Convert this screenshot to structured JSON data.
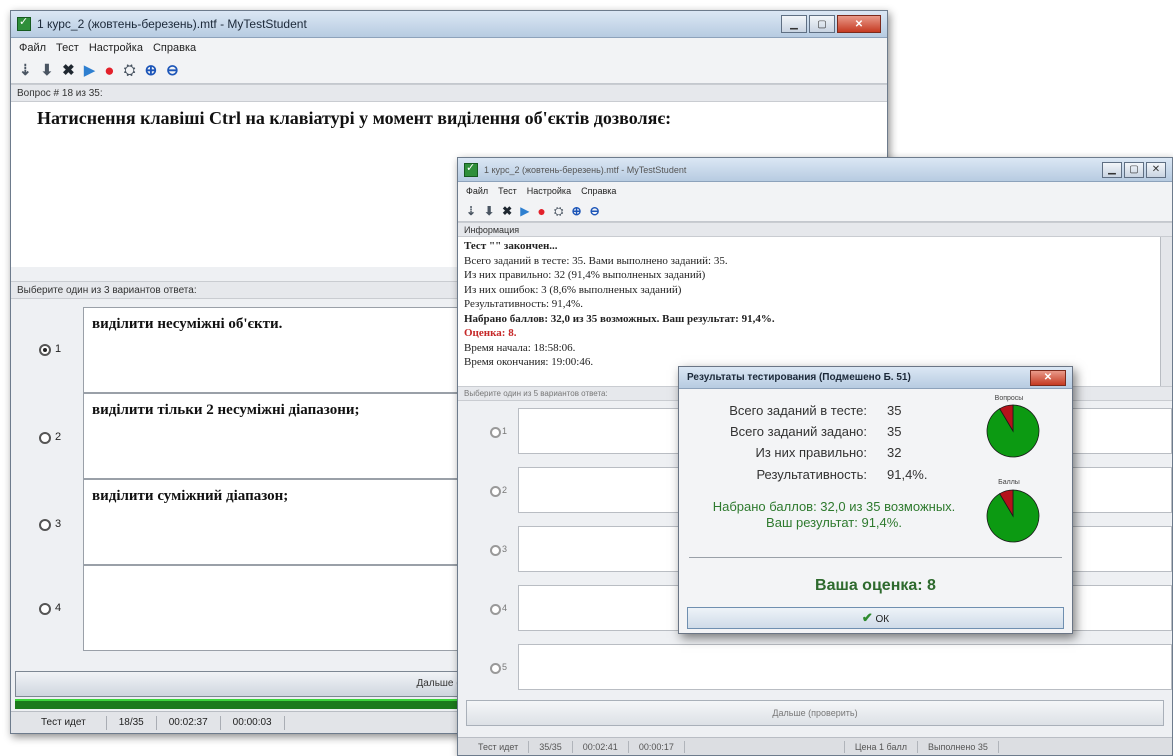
{
  "window_back": {
    "title": "1 курс_2  (жовтень-березень).mtf - MyTestStudent",
    "menu": [
      "Файл",
      "Тест",
      "Настройка",
      "Справка"
    ],
    "question_label": "Вопрос # 18 из 35:",
    "question_text": "Натиснення клавіші Ctrl на клавіатурі у момент виділення  об'єктів дозволяє:",
    "answers_label": "Выберите один из 3 вариантов ответа:",
    "answers": [
      {
        "num": "1",
        "text": "виділити несуміжні об'єкти."
      },
      {
        "num": "2",
        "text": "виділити тільки 2 несуміжні діапазони;"
      },
      {
        "num": "3",
        "text": "виділити суміжний діапазон;"
      },
      {
        "num": "4",
        "text": ""
      }
    ],
    "next_button": "Дальше (пров",
    "status": [
      "Тест идет",
      "18/35",
      "00:02:37",
      "00:00:03"
    ]
  },
  "window_front": {
    "title": "1 курс_2  (жовтень-березень).mtf - MyTestStudent",
    "menu": [
      "Файл",
      "Тест",
      "Настройка",
      "Справка"
    ],
    "info_label": "Информация",
    "info_lines": [
      "Тест \"\" закончен...",
      "Всего заданий в тесте: 35. Вами выполнено заданий: 35.",
      "Из них правильно: 32 (91,4% выполненых заданий)",
      "Из них ошибок: 3 (8,6% выполненых заданий)",
      "Результативность: 91,4%.",
      "Набрано баллов: 32,0 из 35 возможных. Ваш результат: 91,4%.",
      "Оценка: 8.",
      "Время начала: 18:58:06.",
      "Время окончания: 19:00:46."
    ],
    "answers_label": "Выберите один из 5 вариантов ответа:",
    "radios": [
      "1",
      "2",
      "3",
      "4",
      "5"
    ],
    "next_button": "Дальше (проверить)",
    "status": [
      "Тест идет",
      "35/35",
      "00:02:41",
      "00:00:17",
      "Цена 1 балл",
      "Выполнено 35"
    ]
  },
  "dialog": {
    "title": "Результаты тестирования (Подмешено Б. 51)",
    "rows": [
      {
        "label": "Всего заданий в тесте:",
        "value": "35"
      },
      {
        "label": "Всего заданий задано:",
        "value": "35"
      },
      {
        "label": "Из них правильно:",
        "value": "32"
      },
      {
        "label": "Результативность:",
        "value": "91,4%."
      }
    ],
    "score_line1": "Набрано баллов: 32,0 из 35 возможных.",
    "score_line2": "Ваш результат: 91,4%.",
    "grade": "Ваша оценка: 8",
    "ok": "ОК",
    "pie_labels": [
      "Вопросы",
      "Баллы"
    ]
  },
  "chart_data": [
    {
      "type": "pie",
      "slices": [
        {
          "value": 32,
          "color": "#0c9a12"
        },
        {
          "value": 3,
          "color": "#b5121b"
        }
      ]
    },
    {
      "type": "pie",
      "slices": [
        {
          "value": 32,
          "color": "#0c9a12"
        },
        {
          "value": 3,
          "color": "#b5121b"
        }
      ]
    }
  ]
}
